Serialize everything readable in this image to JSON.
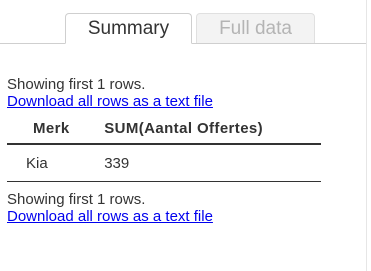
{
  "tabs": {
    "summary": "Summary",
    "full_data": "Full data"
  },
  "top": {
    "showing": "Showing first 1 rows.",
    "download": "Download all rows as a text file"
  },
  "table": {
    "headers": [
      "Merk",
      "SUM(Aantal Offertes)"
    ],
    "rows": [
      [
        "Kia",
        "339"
      ]
    ]
  },
  "bottom": {
    "showing": "Showing first 1 rows.",
    "download": "Download all rows as a text file"
  }
}
